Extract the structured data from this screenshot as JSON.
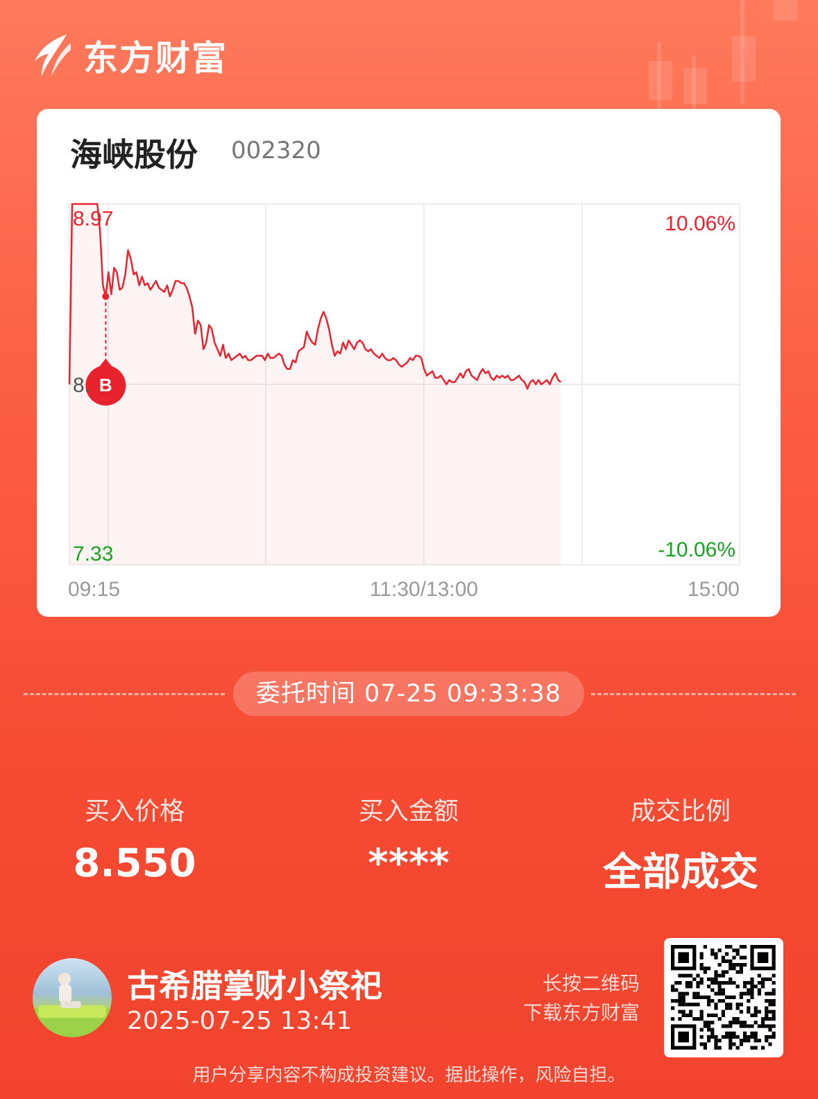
{
  "brand": {
    "name": "东方财富"
  },
  "stock": {
    "name": "海峡股份",
    "code": "002320"
  },
  "chart_data": {
    "type": "line",
    "series": [
      {
        "values": [
          8.15,
          8.97,
          8.97,
          8.97,
          8.97,
          8.97,
          8.97,
          8.97,
          8.97,
          8.97,
          8.97,
          8.84,
          8.6,
          8.55,
          8.66,
          8.56,
          8.68,
          8.66,
          8.58,
          8.59,
          8.65,
          8.76,
          8.72,
          8.65,
          8.66,
          8.6,
          8.64,
          8.6,
          8.61,
          8.58,
          8.6,
          8.62,
          8.59,
          8.58,
          8.57,
          8.6,
          8.55,
          8.58,
          8.62,
          8.62,
          8.61,
          8.61,
          8.59,
          8.55,
          8.5,
          8.38,
          8.44,
          8.42,
          8.31,
          8.34,
          8.42,
          8.4,
          8.34,
          8.31,
          8.28,
          8.33,
          8.27,
          8.29,
          8.26,
          8.27,
          8.28,
          8.29,
          8.27,
          8.28,
          8.26,
          8.26,
          8.27,
          8.28,
          8.28,
          8.28,
          8.26,
          8.29,
          8.27,
          8.27,
          8.28,
          8.29,
          8.28,
          8.24,
          8.22,
          8.22,
          8.26,
          8.25,
          8.3,
          8.31,
          8.32,
          8.39,
          8.36,
          8.34,
          8.33,
          8.4,
          8.45,
          8.48,
          8.45,
          8.4,
          8.33,
          8.28,
          8.3,
          8.29,
          8.34,
          8.31,
          8.35,
          8.33,
          8.31,
          8.34,
          8.35,
          8.34,
          8.31,
          8.3,
          8.31,
          8.29,
          8.28,
          8.27,
          8.29,
          8.27,
          8.26,
          8.26,
          8.27,
          8.26,
          8.24,
          8.23,
          8.24,
          8.25,
          8.27,
          8.26,
          8.28,
          8.28,
          8.27,
          8.22,
          8.19,
          8.2,
          8.21,
          8.18,
          8.18,
          8.19,
          8.17,
          8.15,
          8.17,
          8.16,
          8.16,
          8.18,
          8.2,
          8.18,
          8.21,
          8.22,
          8.19,
          8.18,
          8.17,
          8.2,
          8.22,
          8.2,
          8.21,
          8.18,
          8.17,
          8.19,
          8.18,
          8.19,
          8.18,
          8.19,
          8.17,
          8.17,
          8.18,
          8.19,
          8.17,
          8.16,
          8.13,
          8.16,
          8.17,
          8.15,
          8.17,
          8.15,
          8.16,
          8.17,
          8.15,
          8.18,
          8.2,
          8.17,
          8.16
        ],
        "total_points": 241
      }
    ],
    "prev_close": 8.15,
    "ylim": [
      7.33,
      8.97
    ],
    "y_left_ticks": [
      "8.97",
      "8.",
      "7.33"
    ],
    "y_right_ticks": [
      "10.06%",
      "-10.06%"
    ],
    "x_ticks": [
      "09:15",
      "11:30/13:00",
      "15:00"
    ],
    "buy_marker": {
      "label": "B",
      "index": 13,
      "price": 8.55
    },
    "grid": true,
    "up_color": "#e8232e",
    "down_color": "#16a320"
  },
  "order": {
    "time_label": "委托时间 07-25 09:33:38"
  },
  "stats": [
    {
      "label": "买入价格",
      "value": "8.550"
    },
    {
      "label": "买入金额",
      "value": "****"
    },
    {
      "label": "成交比例",
      "value": "全部成交"
    }
  ],
  "user": {
    "name": "古希腊掌财小祭祀",
    "time": "2025-07-25 13:41"
  },
  "qr": {
    "hint_line1": "长按二维码",
    "hint_line2": "下载东方财富"
  },
  "disclaimer": "用户分享内容不构成投资建议。据此操作，风险自担。"
}
